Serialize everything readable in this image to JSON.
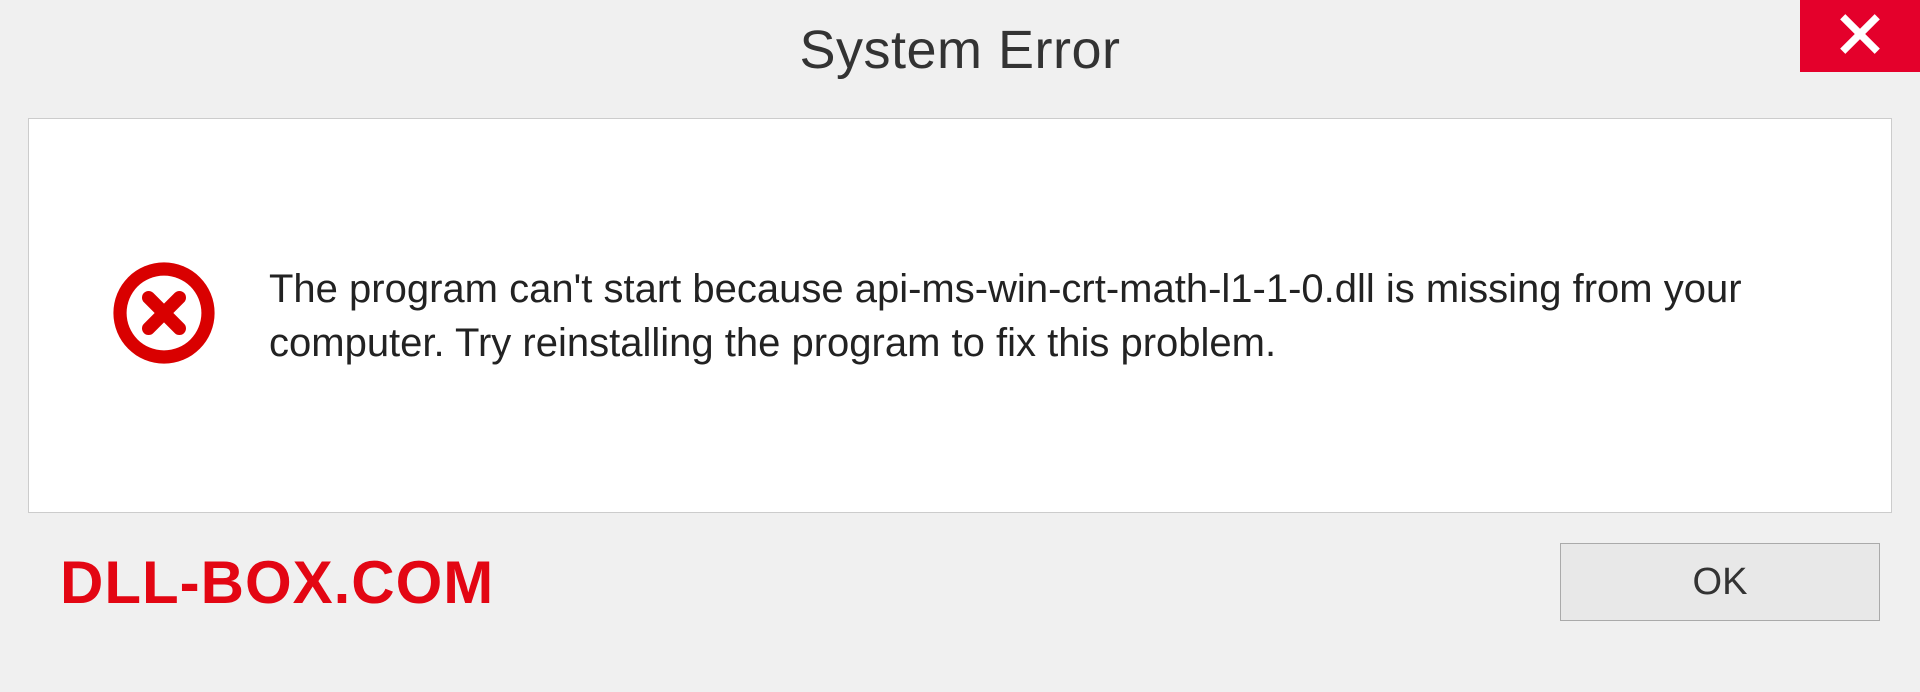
{
  "titlebar": {
    "title": "System Error"
  },
  "body": {
    "message": "The program can't start because api-ms-win-crt-math-l1-1-0.dll is missing from your computer. Try reinstalling the program to fix this problem."
  },
  "footer": {
    "watermark": "DLL-BOX.COM",
    "ok_label": "OK"
  },
  "colors": {
    "close_bg": "#e4002b",
    "error_icon": "#d90000",
    "watermark": "#e30613"
  }
}
